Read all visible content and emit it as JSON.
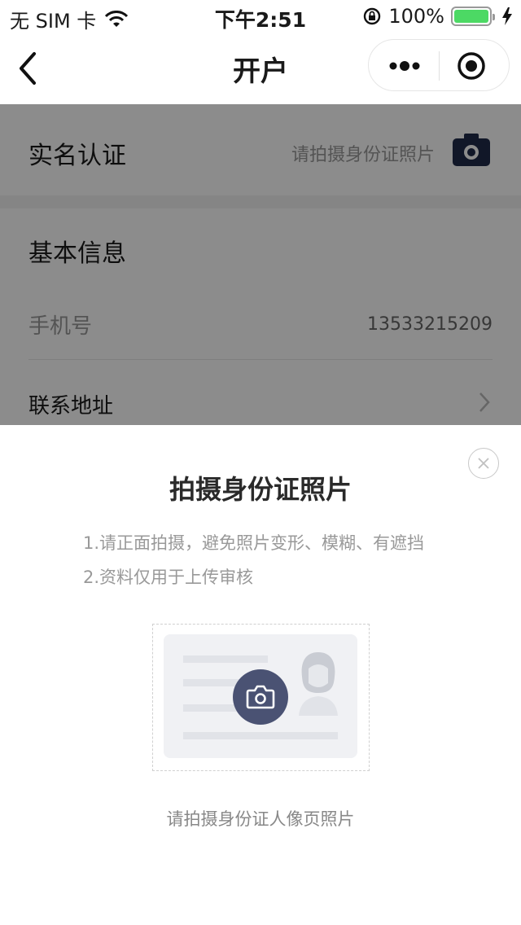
{
  "status_bar": {
    "carrier": "无 SIM 卡",
    "time": "下午2:51",
    "battery": "100%",
    "battery_level": 1.0,
    "icons": [
      "wifi-icon",
      "orientation-lock-icon",
      "battery-icon",
      "charging-icon"
    ]
  },
  "nav": {
    "title": "开户",
    "icons": [
      "back-icon",
      "more-icon",
      "close-miniprogram-icon"
    ]
  },
  "realname": {
    "title": "实名认证",
    "hint": "请拍摄身份证照片",
    "icon": "camera-icon"
  },
  "basic": {
    "title": "基本信息",
    "phone_label": "手机号",
    "phone_value": "13533215209",
    "address_label": "联系地址"
  },
  "sheet": {
    "title": "拍摄身份证照片",
    "tips": [
      "1.请正面拍摄，避免照片变形、模糊、有遮挡",
      "2.资料仅用于上传审核"
    ],
    "caption": "请拍摄身份证人像页照片"
  },
  "colors": {
    "accent": "#4a5273",
    "battery": "#4cd964",
    "mask": "rgba(0,0,0,0.45)"
  }
}
